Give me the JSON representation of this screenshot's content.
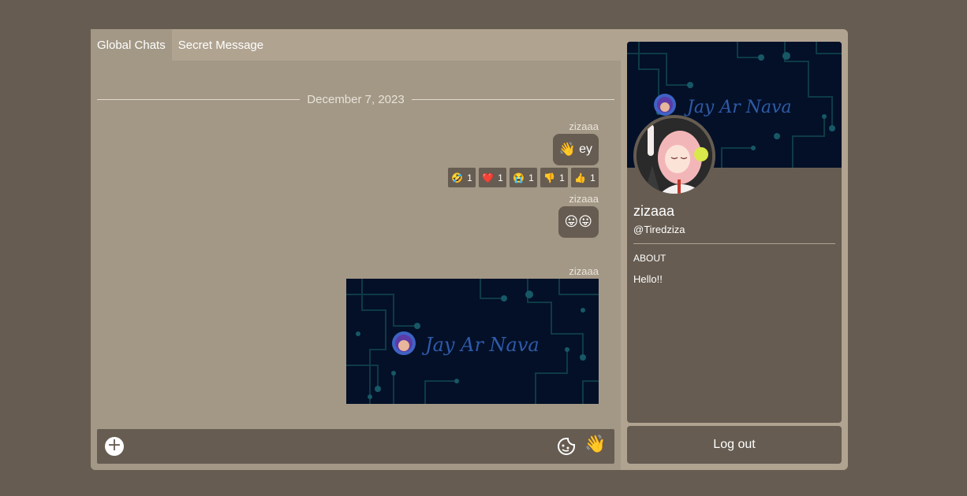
{
  "tabs": [
    {
      "label": "Global Chats",
      "active": true
    },
    {
      "label": "Secret Message",
      "active": false
    }
  ],
  "date_divider": "December 7, 2023",
  "messages": [
    {
      "author": "zizaaa",
      "emoji": "👋",
      "text": "ey"
    },
    {
      "author": "zizaaa",
      "emoji": "😛😛",
      "text": ""
    },
    {
      "author": "zizaaa",
      "type": "image",
      "image_text": "Jay Ar Nava"
    }
  ],
  "reactions": [
    {
      "emoji": "🤣",
      "count": "1"
    },
    {
      "emoji": "❤️",
      "count": "1"
    },
    {
      "emoji": "😭",
      "count": "1"
    },
    {
      "emoji": "👎",
      "count": "1"
    },
    {
      "emoji": "👍",
      "count": "1"
    }
  ],
  "composer": {
    "placeholder": "",
    "add_icon": "plus-circle-icon",
    "sticker_icon": "sticker-icon",
    "wave_emoji": "👋"
  },
  "profile": {
    "name": "zizaaa",
    "handle": "@Tiredziza",
    "about_heading": "ABOUT",
    "about_text": "Hello!!",
    "banner_text": "Jay Ar Nava"
  },
  "logout_label": "Log out",
  "colors": {
    "background": "#665c51",
    "panel": "#b0a390",
    "chat_bg": "#a39886",
    "bubble": "#665c51",
    "banner": "#031028",
    "banner_accent": "#2f5aa8"
  }
}
